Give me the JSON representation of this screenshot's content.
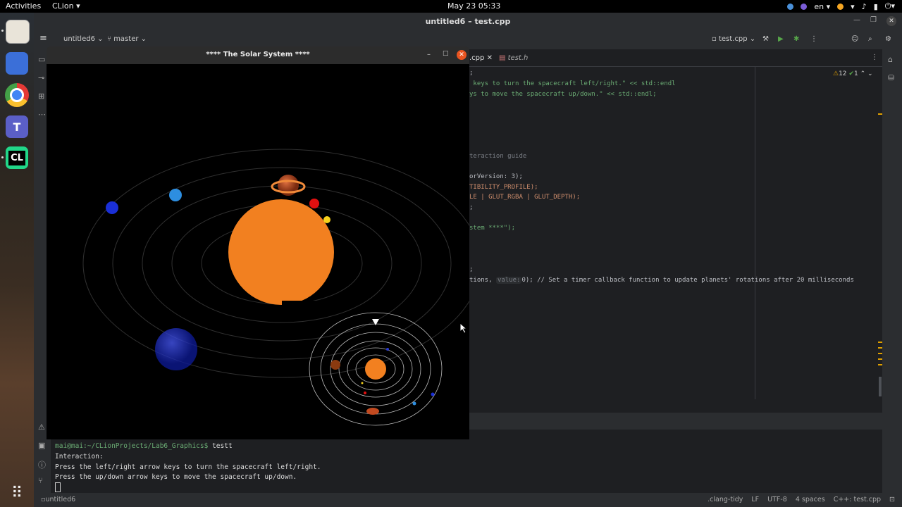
{
  "topbar": {
    "activities": "Activities",
    "app_name": "CLion",
    "clock": "May 23  05:33",
    "lang": "en"
  },
  "clion": {
    "window_title": "untitled6 – test.cpp",
    "project": "untitled6",
    "branch": "master",
    "run_config": "test.cpp",
    "tabs": [
      ".cpp",
      "test.h"
    ],
    "problems": {
      "warnings": "12",
      "checks": "1"
    },
    "code_lines": [
      ";",
      " keys to turn the spacecraft left/right.\" << std::endl",
      "ys to move the spacecraft up/down.\" << std::endl;",
      "teraction guide",
      "orVersion: 3);",
      "TIBILITY_PROFILE);",
      "LE | GLUT_RGBA | GLUT_DEPTH);",
      ";",
      "stem ****\");",
      ";",
      "tions,",
      "value:",
      "0); // Set a timer callback function to update planets' rotations after 20 milliseconds"
    ]
  },
  "terminal": {
    "prompt": "mai@mai:~/CLionProjects/Lab6_Graphics$",
    "command": " testt",
    "lines": [
      "Interaction:",
      "Press the left/right arrow keys to turn the spacecraft left/right.",
      "Press the up/down arrow keys to move the spacecraft up/down."
    ]
  },
  "statusbar": {
    "project": "untitled6",
    "items": [
      ".clang-tidy",
      "LF",
      "UTF-8",
      "4 spaces",
      "C++: test.cpp"
    ]
  },
  "solar_window": {
    "title": "**** The Solar System ****",
    "colors": {
      "sun": "#f28020",
      "blue_planet": "#1a2fd6",
      "cyan_planet": "#2d8ee0",
      "red_planet": "#e21010",
      "yellow_planet": "#f7d21c",
      "saturn": "#d0562a"
    }
  }
}
